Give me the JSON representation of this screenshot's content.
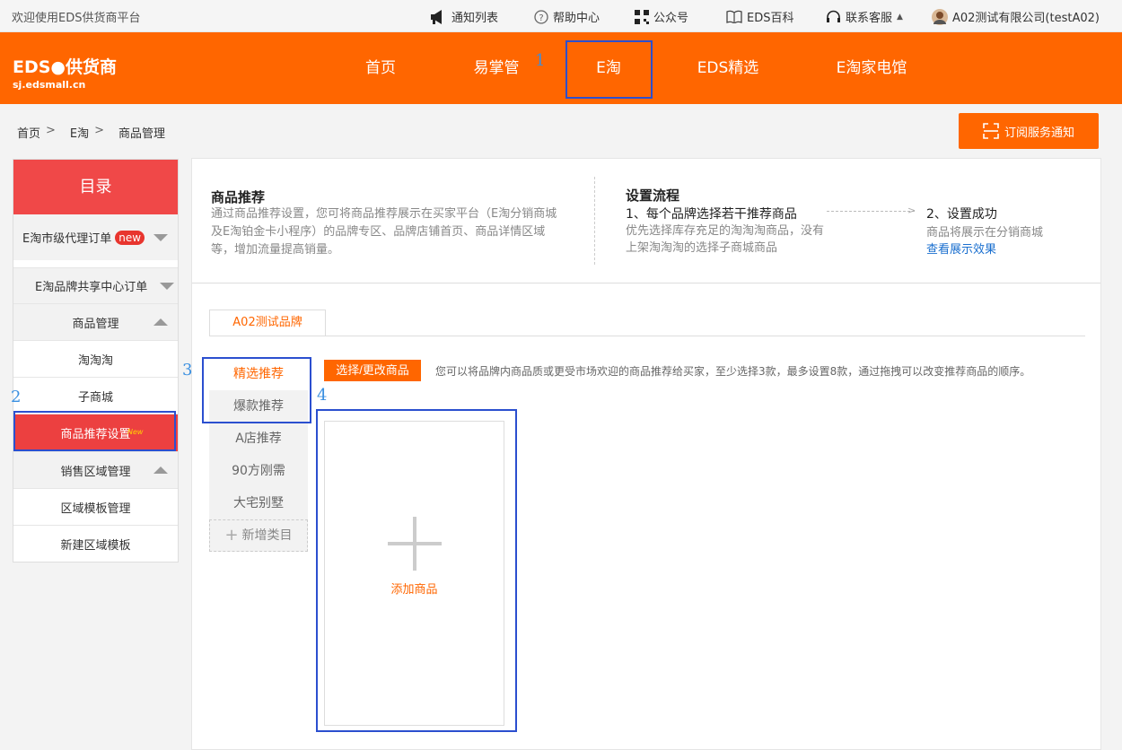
{
  "topbar": {
    "welcome": "欢迎使用EDS供货商平台",
    "links": [
      {
        "icon": "megaphone-icon",
        "label": "通知列表"
      },
      {
        "icon": "help-circle-icon",
        "label": "帮助中心"
      },
      {
        "icon": "qr-code-icon",
        "label": "公众号"
      },
      {
        "icon": "book-icon",
        "label": "EDS百科"
      },
      {
        "icon": "headset-icon",
        "label": "联系客服"
      }
    ],
    "account": "A02测试有限公司(testA02)"
  },
  "header": {
    "logo_line1": "EDS●供货商",
    "logo_line2": "sj.edsmall.cn",
    "nav": [
      "首页",
      "易掌管",
      "E淘",
      "EDS精选",
      "E淘家电馆"
    ],
    "active_nav": "E淘"
  },
  "annotations": [
    "1",
    "2",
    "3",
    "4"
  ],
  "breadcrumb": [
    "首页",
    "E淘",
    "商品管理"
  ],
  "breadcrumb_sep": ">",
  "subscribe_button": "订阅服务通知",
  "sidebar": {
    "title": "目录",
    "items": [
      {
        "label": "E淘市级代理订单",
        "badge": "new"
      },
      {
        "label": "E淘品牌共享中心订单"
      },
      {
        "label": "商品管理"
      },
      {
        "label": "淘淘淘"
      },
      {
        "label": "子商城"
      },
      {
        "label": "商品推荐设置",
        "badge": "New"
      },
      {
        "label": "销售区域管理"
      },
      {
        "label": "区域模板管理"
      },
      {
        "label": "新建区域模板"
      }
    ]
  },
  "intro": {
    "title": "商品推荐",
    "description": "通过商品推荐设置，您可将商品推荐展示在买家平台（E淘分销商城及E淘铂金卡小程序）的品牌专区、品牌店铺首页、商品详情区域等，增加流量提高销量。"
  },
  "flow": {
    "title": "设置流程",
    "step1": "1、每个品牌选择若干推荐商品",
    "step1_desc": "优先选择库存充足的淘淘淘商品，没有上架淘淘淘的选择子商城商品",
    "step2": "2、设置成功",
    "step2_desc": "商品将展示在分销商城",
    "link": "查看展示效果"
  },
  "brand_tab": "A02测试品牌",
  "categories": [
    "精选推荐",
    "爆款推荐",
    "A店推荐",
    "90方刚需",
    "大宅别墅"
  ],
  "add_category": "新增类目",
  "choose_button": "选择/更改商品",
  "hint": "您可以将品牌内商品质或更受市场欢迎的商品推荐给买家，至少选择3款，最多设置8款，通过拖拽可以改变推荐商品的顺序。",
  "add_product": "添加商品",
  "colors": {
    "brand_orange": "#ff6600",
    "sidebar_red": "#f04848",
    "highlight_blue": "#2b4fcf",
    "link_blue": "#1a6fcf"
  }
}
